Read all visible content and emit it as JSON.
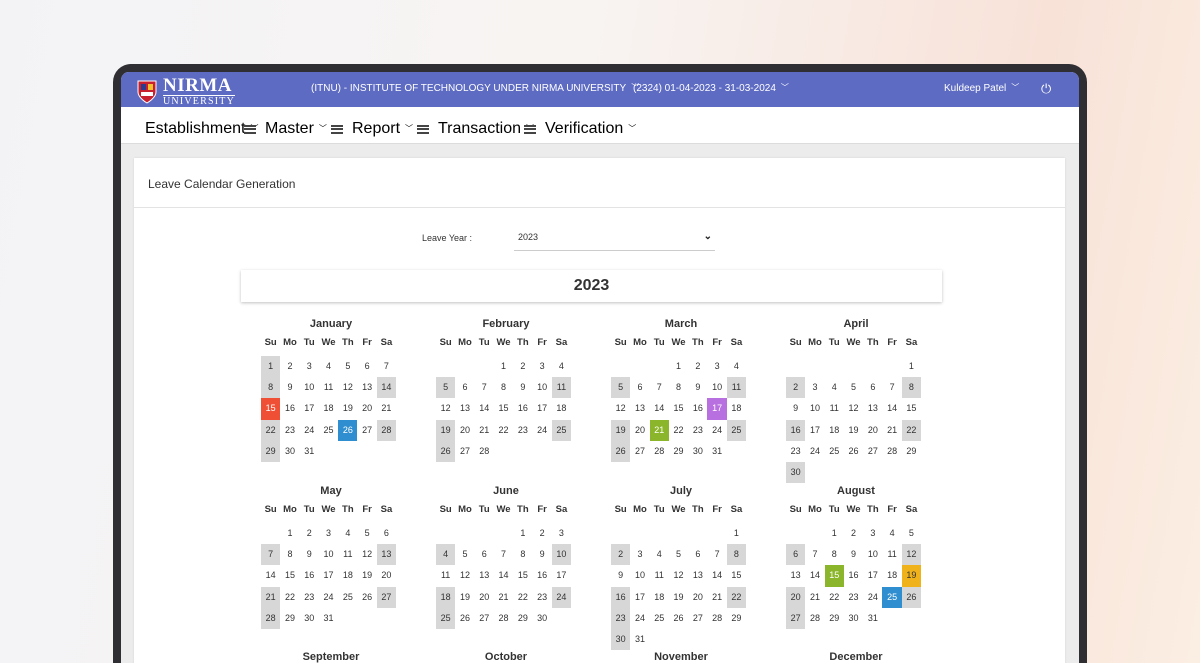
{
  "header": {
    "logo_line1": "NIRMA",
    "logo_line2": "UNIVERSITY",
    "institute": "(ITNU) - INSTITUTE OF TECHNOLOGY UNDER NIRMA UNIVERSITY",
    "period": "(2324) 01-04-2023 - 31-03-2024",
    "user": "Kuldeep Patel",
    "power_icon": "⏻"
  },
  "menu": {
    "items": [
      "Establishment",
      "Master",
      "Report",
      "Transaction",
      "Verification"
    ]
  },
  "page": {
    "title": "Leave Calendar Generation",
    "leave_year_label": "Leave Year :",
    "leave_year_value": "2023",
    "year_heading": "2023"
  },
  "calendar": {
    "weekday_headers": [
      "Su",
      "Mo",
      "Tu",
      "We",
      "Th",
      "Fr",
      "Sa"
    ],
    "months": [
      {
        "name": "January",
        "start": 0,
        "days": 31,
        "weekends": [
          1,
          8,
          14,
          22,
          28,
          29
        ],
        "holidays": [
          {
            "d": 15,
            "c": "hr"
          },
          {
            "d": 26,
            "c": "hb"
          }
        ]
      },
      {
        "name": "February",
        "start": 3,
        "days": 28,
        "weekends": [
          5,
          11,
          19,
          25,
          26
        ],
        "holidays": []
      },
      {
        "name": "March",
        "start": 3,
        "days": 31,
        "weekends": [
          5,
          11,
          19,
          25,
          26
        ],
        "holidays": [
          {
            "d": 17,
            "c": "hp"
          },
          {
            "d": 21,
            "c": "hg"
          }
        ]
      },
      {
        "name": "April",
        "start": 6,
        "days": 30,
        "weekends": [
          2,
          8,
          16,
          22,
          30
        ],
        "holidays": []
      },
      {
        "name": "May",
        "start": 1,
        "days": 31,
        "weekends": [
          7,
          13,
          21,
          27,
          28
        ],
        "holidays": []
      },
      {
        "name": "June",
        "start": 4,
        "days": 30,
        "weekends": [
          4,
          10,
          18,
          24,
          25
        ],
        "holidays": []
      },
      {
        "name": "July",
        "start": 6,
        "days": 31,
        "weekends": [
          2,
          8,
          16,
          22,
          23,
          30
        ],
        "holidays": []
      },
      {
        "name": "August",
        "start": 2,
        "days": 31,
        "weekends": [
          6,
          12,
          20,
          26,
          27
        ],
        "holidays": [
          {
            "d": 15,
            "c": "hg"
          },
          {
            "d": 19,
            "c": "hy"
          },
          {
            "d": 25,
            "c": "hb"
          }
        ]
      },
      {
        "name": "September",
        "start": 5,
        "days": 30,
        "weekends": [],
        "holidays": []
      },
      {
        "name": "October",
        "start": 0,
        "days": 31,
        "weekends": [],
        "holidays": []
      },
      {
        "name": "November",
        "start": 3,
        "days": 30,
        "weekends": [],
        "holidays": []
      },
      {
        "name": "December",
        "start": 5,
        "days": 31,
        "weekends": [],
        "holidays": []
      }
    ]
  },
  "colors": {
    "topbar": "#5d6bc2",
    "weekend": "#d7d7d7",
    "holiday_red": "#ef4f35",
    "holiday_blue": "#2f8ed0",
    "holiday_purple": "#b86fe0",
    "holiday_green": "#8bb52a",
    "holiday_yellow": "#f0b21a"
  }
}
